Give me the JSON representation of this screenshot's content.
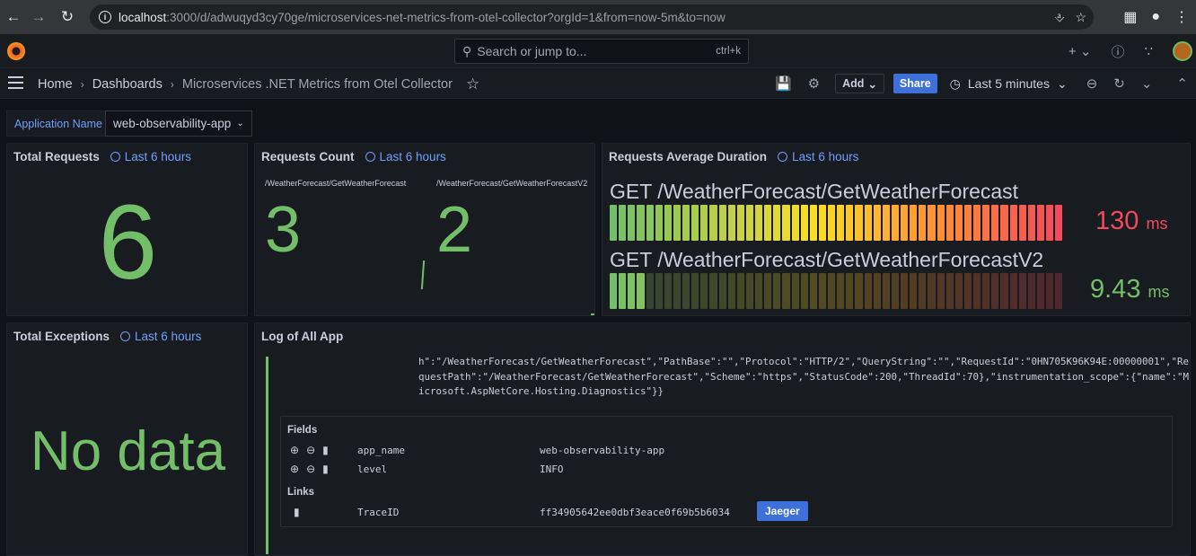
{
  "browser": {
    "url_host": "localhost",
    "url_rest": ":3000/d/adwuqyd3cy70ge/microservices-net-metrics-from-otel-collector?orgId=1&from=now-5m&to=now"
  },
  "topnav": {
    "search_placeholder": "Search or jump to...",
    "search_shortcut": "ctrl+k",
    "plus_label": "+"
  },
  "toolbar": {
    "breadcrumbs": [
      "Home",
      "Dashboards",
      "Microservices .NET Metrics from Otel Collector"
    ],
    "add_label": "Add",
    "share_label": "Share",
    "time_range": "Last 5 minutes"
  },
  "variables": {
    "label": "Application Name",
    "value": "web-observability-app"
  },
  "panels": {
    "total_requests": {
      "title": "Total Requests",
      "time_info": "Last 6 hours",
      "value": "6"
    },
    "requests_count": {
      "title": "Requests Count",
      "time_info": "Last 6 hours",
      "items": [
        {
          "label": "/WeatherForecast/GetWeatherForecast",
          "value": "3"
        },
        {
          "label": "/WeatherForecast/GetWeatherForecastV2",
          "value": "2"
        }
      ]
    },
    "avg_duration": {
      "title": "Requests Average Duration",
      "time_info": "Last 6 hours",
      "bars": [
        {
          "name": "GET /WeatherForecast/GetWeatherForecast",
          "value": "130",
          "unit": "ms",
          "fill_fraction": 1.0,
          "color": "#f2495c"
        },
        {
          "name": "GET /WeatherForecast/GetWeatherForecastV2",
          "value": "9.43",
          "unit": "ms",
          "fill_fraction": 0.07,
          "color": "#73bf69"
        }
      ]
    },
    "total_exceptions": {
      "title": "Total Exceptions",
      "time_info": "Last 6 hours",
      "value": "No data"
    },
    "log": {
      "title": "Log of All App",
      "body": "h\":\"/WeatherForecast/GetWeatherForecast\",\"PathBase\":\"\",\"Protocol\":\"HTTP/2\",\"QueryString\":\"\",\"RequestId\":\"0HN705K96K94E:00000001\",\"RequestPath\":\"/WeatherForecast/GetWeatherForecast\",\"Scheme\":\"https\",\"StatusCode\":200,\"ThreadId\":70},\"instrumentation_scope\":{\"name\":\"Microsoft.AspNetCore.Hosting.Diagnostics\"}}",
      "fields_heading": "Fields",
      "fields": [
        {
          "key": "app_name",
          "value": "web-observability-app"
        },
        {
          "key": "level",
          "value": "INFO"
        }
      ],
      "links_heading": "Links",
      "links": [
        {
          "key": "TraceID",
          "value": "ff34905642ee0dbf3eace0f69b5b6034",
          "button": "Jaeger"
        }
      ]
    }
  },
  "colors": {
    "green": "#73bf69",
    "red": "#f2495c",
    "blue": "#6e9fff",
    "button_blue": "#3d71d9"
  }
}
